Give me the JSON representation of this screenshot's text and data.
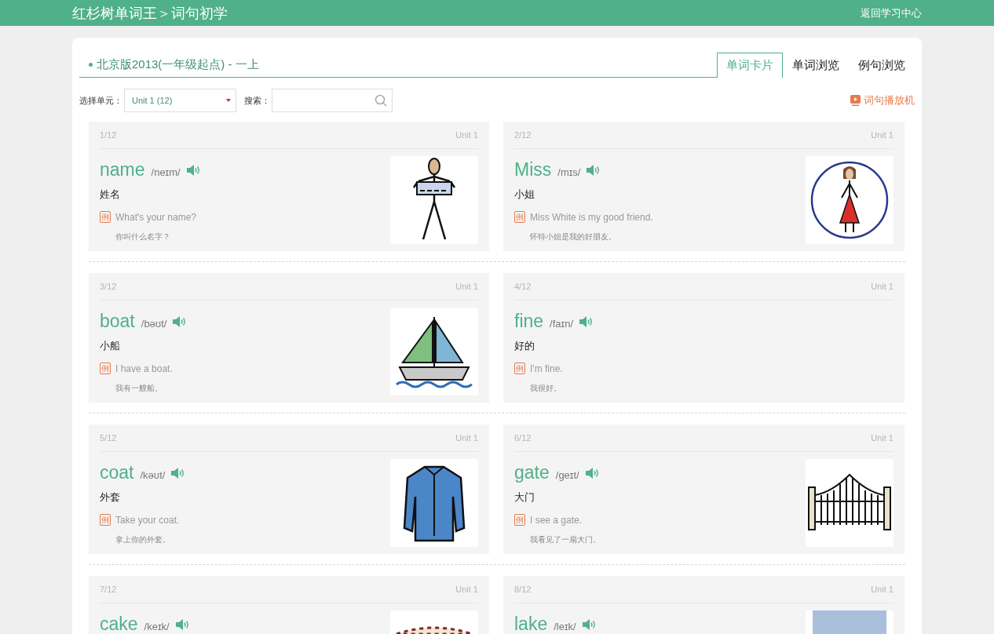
{
  "header": {
    "title": "红杉树单词王＞词句初学",
    "back_link": "返回学习中心"
  },
  "book": {
    "title": "北京版2013(一年级起点) - 一上"
  },
  "tabs": [
    {
      "label": "单词卡片",
      "selected": true
    },
    {
      "label": "单词浏览",
      "selected": false
    },
    {
      "label": "例句浏览",
      "selected": false
    }
  ],
  "toolbar": {
    "unit_label": "选择单元：",
    "unit_value": "Unit 1 (12)",
    "search_label": "搜索：",
    "player_link": "词句播放机"
  },
  "cards": [
    {
      "index": "1/12",
      "unit": "Unit 1",
      "word": "name",
      "phonetic": "/neɪm/",
      "meaning": "姓名",
      "example_mark": "例",
      "example": "What's your name?",
      "translation": "你叫什么名字？"
    },
    {
      "index": "2/12",
      "unit": "Unit 1",
      "word": "Miss",
      "phonetic": "/mɪs/",
      "meaning": "小姐",
      "example_mark": "例",
      "example": "Miss White is my good friend.",
      "translation": "怀特小姐是我的好朋友。"
    },
    {
      "index": "3/12",
      "unit": "Unit 1",
      "word": "boat",
      "phonetic": "/bəʊt/",
      "meaning": "小船",
      "example_mark": "例",
      "example": "I have a boat.",
      "translation": "我有一艘船。"
    },
    {
      "index": "4/12",
      "unit": "Unit 1",
      "word": "fine",
      "phonetic": "/faɪn/",
      "meaning": "好的",
      "example_mark": "例",
      "example": "I'm fine.",
      "translation": "我很好。"
    },
    {
      "index": "5/12",
      "unit": "Unit 1",
      "word": "coat",
      "phonetic": "/kəʊt/",
      "meaning": "外套",
      "example_mark": "例",
      "example": "Take your coat.",
      "translation": "拿上你的外套。"
    },
    {
      "index": "6/12",
      "unit": "Unit 1",
      "word": "gate",
      "phonetic": "/ɡeɪt/",
      "meaning": "大门",
      "example_mark": "例",
      "example": "I see a gate.",
      "translation": "我看见了一扇大门。"
    },
    {
      "index": "7/12",
      "unit": "Unit 1",
      "word": "cake",
      "phonetic": "/keɪk/"
    },
    {
      "index": "8/12",
      "unit": "Unit 1",
      "word": "lake",
      "phonetic": "/leɪk/"
    }
  ]
}
